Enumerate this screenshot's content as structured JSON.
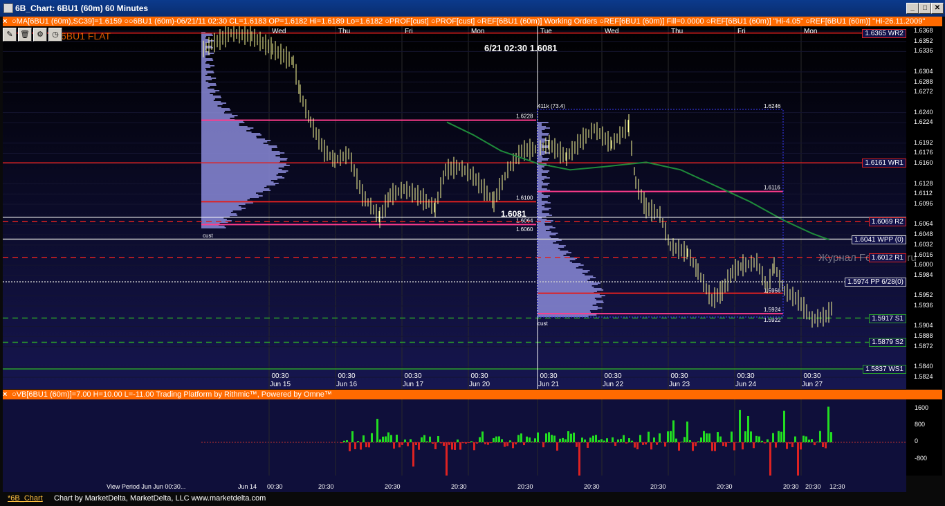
{
  "window": {
    "title": "6B_Chart: 6BU1 (60m) 60 Minutes",
    "min_label": "_",
    "max_label": "□",
    "close_label": "✕"
  },
  "study_bar_top": {
    "text": "○MA[6BU1 (60m),SC39]=1.6159  ○○6BU1 (60m)-06/21/11 02:30 CL=1.6183 OP=1.6182 Hi=1.6189 Lo=1.6182  ○PROF[cust]  ○PROF[cust]  ○REF[6BU1 (60m)] Working Orders  ○REF[6BU1 (60m)] Fill=0.0000  ○REF[6BU1 (60m)] \"Hi-4.05\"  ○REF[6BU1 (60m)] \"Hi-26.11.2009\""
  },
  "study_bar_bottom": {
    "text": "○VB[6BU1 (60m)]=7.00 H=10.00 L=-11.00   Trading Platform by Rithmic™, Powered by Omne™"
  },
  "toolbar": {
    "flat_label": "6BU1 FLAT"
  },
  "cursor_readout": "6/21 02:30  1.6081",
  "price_tag": "1.6081",
  "watermark": "Журнал ForTrader.ru",
  "day_labels": [
    "Wed",
    "Thu",
    "Fri",
    "Mon",
    "Tue",
    "Wed",
    "Thu",
    "Fri",
    "Mon"
  ],
  "time_labels": [
    {
      "t": "00:30",
      "d": "Jun 15"
    },
    {
      "t": "00:30",
      "d": "Jun 16"
    },
    {
      "t": "00:30",
      "d": "Jun 17"
    },
    {
      "t": "00:30",
      "d": "Jun 20"
    },
    {
      "t": "00:30",
      "d": "Jun 21"
    },
    {
      "t": "00:30",
      "d": "Jun 22"
    },
    {
      "t": "00:30",
      "d": "Jun 23"
    },
    {
      "t": "00:30",
      "d": "Jun 24"
    },
    {
      "t": "00:30",
      "d": "Jun 27"
    }
  ],
  "price_axis": [
    "1.6368",
    "1.6352",
    "1.6336",
    "1.6304",
    "1.6288",
    "1.6272",
    "1.6240",
    "1.6224",
    "1.6192",
    "1.6176",
    "1.6160",
    "1.6128",
    "1.6112",
    "1.6096",
    "1.6064",
    "1.6048",
    "1.6032",
    "1.6016",
    "1.6000",
    "1.5984",
    "1.5952",
    "1.5936",
    "1.5904",
    "1.5888",
    "1.5872",
    "1.5840",
    "1.5824"
  ],
  "levels": [
    {
      "label": "1.6365 WR2",
      "value": 1.6365,
      "color": "#e02020",
      "style": "solid"
    },
    {
      "label": "1.6161 WR1",
      "value": 1.6161,
      "color": "#e02020",
      "style": "solid"
    },
    {
      "label": "1.6069 R2",
      "value": 1.6069,
      "color": "#e02020",
      "style": "dashed"
    },
    {
      "label": "1.6041 WPP (0)",
      "value": 1.6041,
      "color": "#d0d0d0",
      "style": "solid"
    },
    {
      "label": "1.6012 R1",
      "value": 1.6012,
      "color": "#e02020",
      "style": "dashed"
    },
    {
      "label": "1.5974 PP 6/28(0)",
      "value": 1.5974,
      "color": "#d0d0d0",
      "style": "dotted"
    },
    {
      "label": "1.5917 S1",
      "value": 1.5917,
      "color": "#2aa02a",
      "style": "dashed"
    },
    {
      "label": "1.5879 S2",
      "value": 1.5879,
      "color": "#2aa02a",
      "style": "dashed"
    },
    {
      "label": "1.5837 WS1",
      "value": 1.5837,
      "color": "#2aa02a",
      "style": "solid"
    }
  ],
  "profile_labels": {
    "p1": [
      "1.6228",
      "1.6100",
      "1.6064",
      "1.6060",
      "cust"
    ],
    "p2": [
      "411k (73.4)",
      "1.6246",
      "1.6116",
      "1.5956",
      "1.5924",
      "1.5922",
      "cust"
    ]
  },
  "volume_axis": [
    "1600",
    "800",
    "0",
    "-800"
  ],
  "volume_time_labels": [
    "Jun 14",
    "00:30",
    "20:30",
    "20:30",
    "20:30",
    "20:30",
    "20:30",
    "20:30",
    "20:30",
    "20:30",
    "20:30",
    "12:30"
  ],
  "view_period": "View Period Jun Jun 00:30...",
  "bottom": {
    "tab": "*6B_Chart",
    "credit": "Chart by MarketDelta, MarketDelta, LLC www.marketdelta.com"
  },
  "colors": {
    "chart_bg": "#0f0f3a",
    "accent": "#ff6a00",
    "bars": "#ffff99",
    "ma": "#1e8a3a",
    "profile": "#8a8ad8"
  }
}
